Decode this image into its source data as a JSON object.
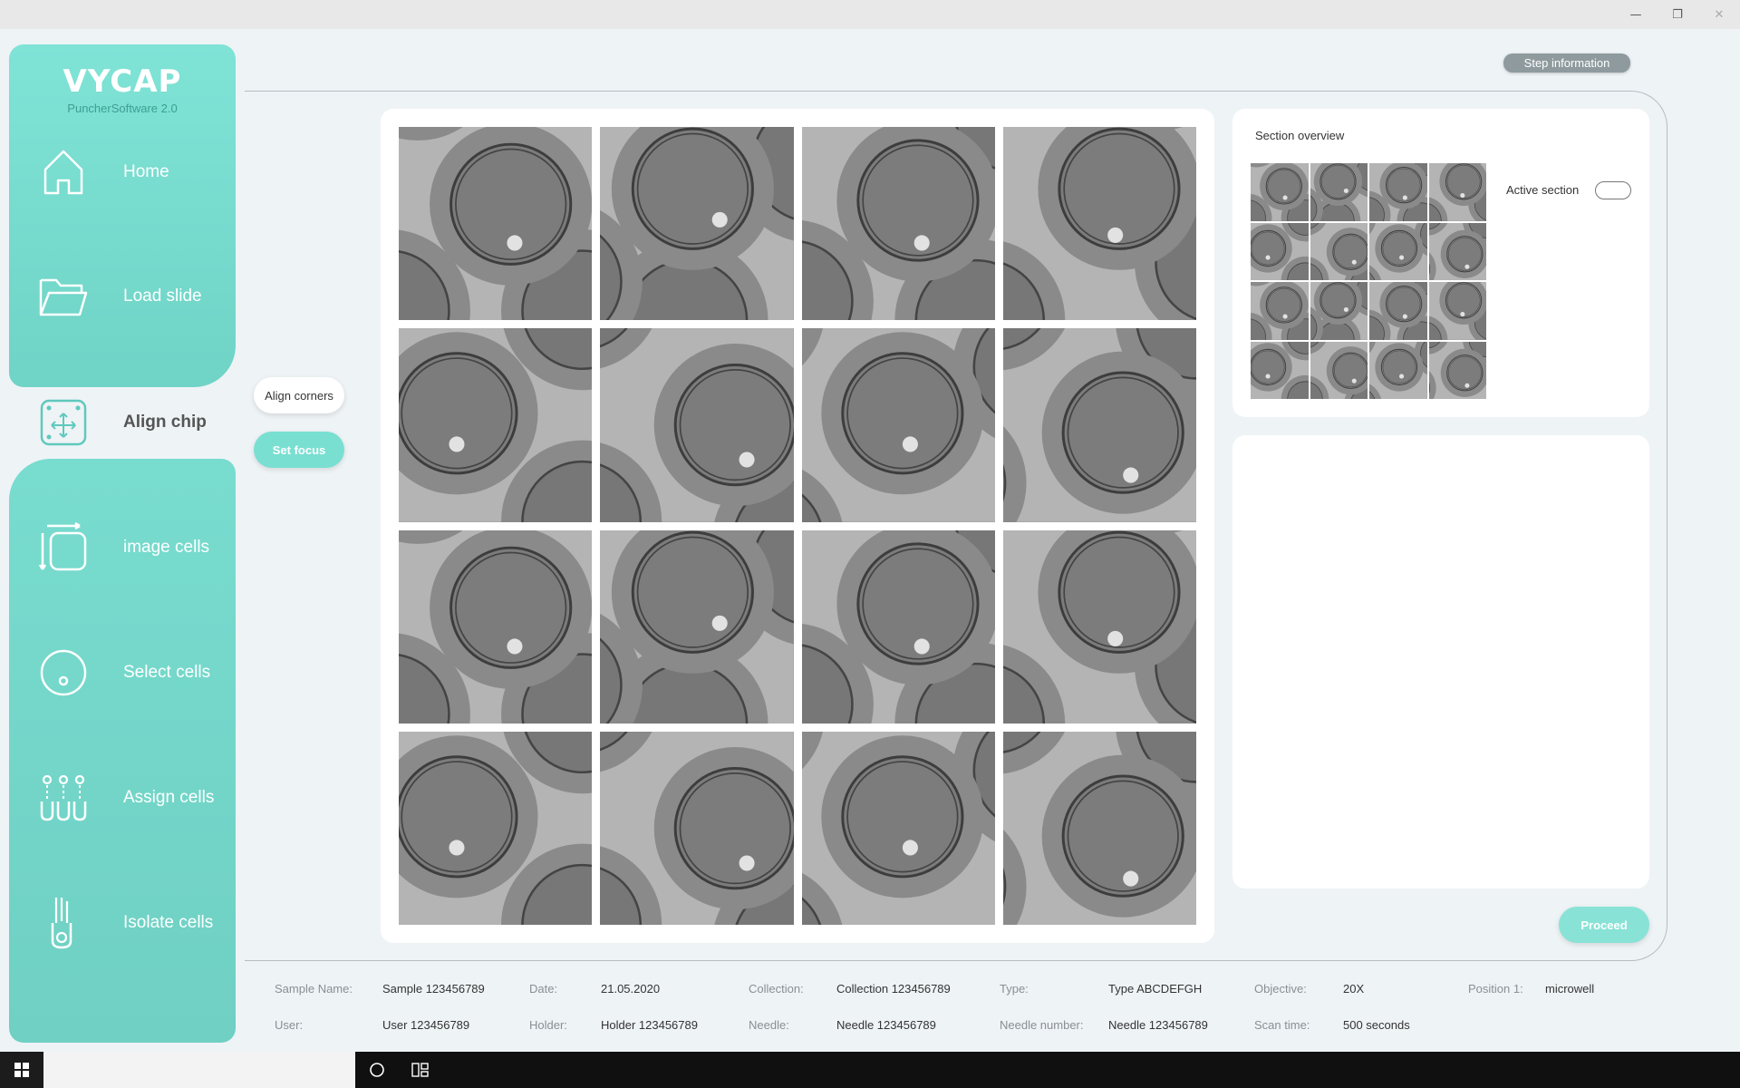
{
  "window": {
    "buttons": [
      "minimize",
      "restore",
      "close"
    ]
  },
  "app": {
    "logo_title": "VYCAP",
    "logo_subtitle": "PuncherSoftware 2.0"
  },
  "sidebar": {
    "items": [
      {
        "label": "Home",
        "icon": "home-icon"
      },
      {
        "label": "Load slide",
        "icon": "folder-icon"
      },
      {
        "label": "Align chip",
        "icon": "align-chip-icon",
        "active": true
      },
      {
        "label": "image cells",
        "icon": "image-cells-icon"
      },
      {
        "label": "Select cells",
        "icon": "select-cells-icon"
      },
      {
        "label": "Assign cells",
        "icon": "assign-cells-icon"
      },
      {
        "label": "Isolate cells",
        "icon": "isolate-cells-icon"
      }
    ]
  },
  "substeps": {
    "align_corners": "Align corners",
    "set_focus": "Set focus"
  },
  "header": {
    "step_information": "Step information"
  },
  "overview": {
    "title": "Section overview",
    "active_section_label": "Active section",
    "active_section_on": false
  },
  "actions": {
    "proceed": "Proceed"
  },
  "info": {
    "row1": [
      {
        "key": "Sample Name:",
        "value": "Sample 123456789"
      },
      {
        "key": "Date:",
        "value": "21.05.2020"
      },
      {
        "key": "Collection:",
        "value": "Collection 123456789"
      },
      {
        "key": "Type:",
        "value": "Type ABCDEFGH"
      },
      {
        "key": "Objective:",
        "value": "20X"
      },
      {
        "key": "Position 1:",
        "value": "microwell"
      }
    ],
    "row2": [
      {
        "key": "User:",
        "value": "User 123456789"
      },
      {
        "key": "Holder:",
        "value": "Holder 123456789"
      },
      {
        "key": "Needle:",
        "value": "Needle 123456789"
      },
      {
        "key": "Needle number:",
        "value": "Needle 123456789"
      },
      {
        "key": "Scan time:",
        "value": "500 seconds"
      }
    ]
  },
  "colors": {
    "accent": "#79dfd1",
    "sidebar": "#6fd3c6",
    "background": "#eef3f6",
    "step_info": "#8e9a9e"
  }
}
